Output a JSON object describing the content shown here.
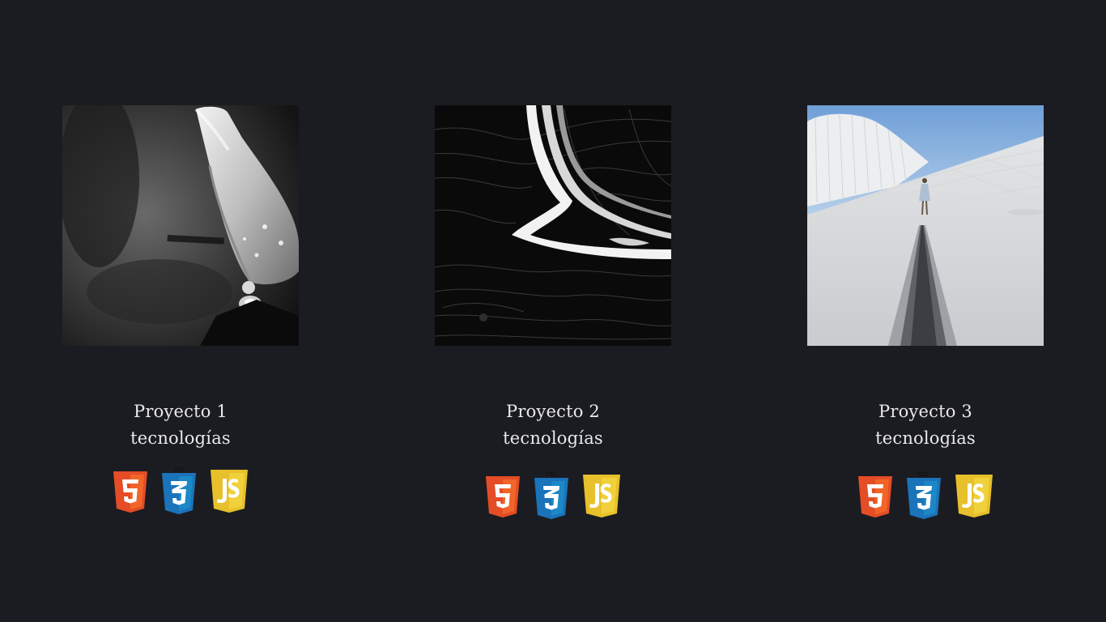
{
  "projects": [
    {
      "title": "Proyecto 1",
      "subtitle": "tecnologías",
      "image": "flower-droplet-photo",
      "techs": [
        "html5-icon",
        "css3-icon",
        "javascript-icon"
      ]
    },
    {
      "title": "Proyecto 2",
      "subtitle": "tecnologías",
      "image": "marble-swirl-photo",
      "techs": [
        "html5-icon",
        "css3-icon",
        "javascript-icon"
      ]
    },
    {
      "title": "Proyecto 3",
      "subtitle": "tecnologías",
      "image": "white-architecture-photo",
      "techs": [
        "html5-icon",
        "css3-icon",
        "javascript-icon"
      ]
    }
  ],
  "colors": {
    "background": "#1b1c21",
    "text": "#e9e9ea",
    "html5": "#e44d26",
    "css3": "#1b73ba",
    "javascript": "#e7c02b"
  }
}
